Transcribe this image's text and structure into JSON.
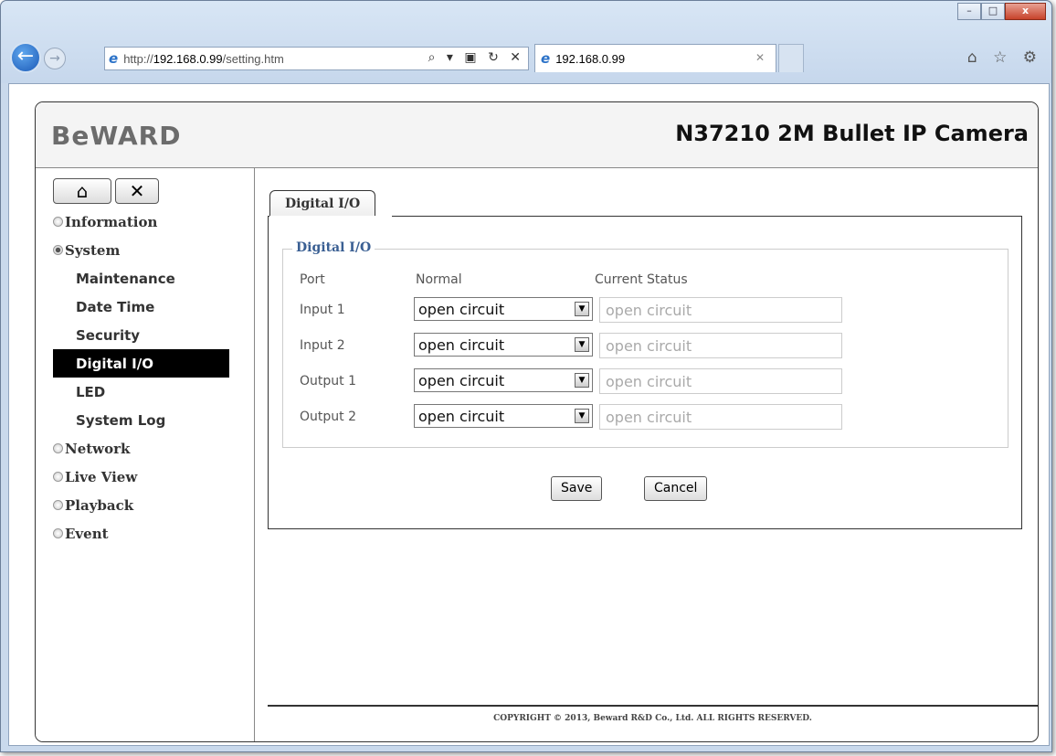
{
  "browser": {
    "url_prefix": "http://",
    "url_host": "192.168.0.99",
    "url_path": "/setting.htm",
    "address_tools": "⌕ ▾ ▣ ↻ ✕",
    "tab_title": "192.168.0.99",
    "tab_close": "✕",
    "back_glyph": "←",
    "forward_glyph": "→",
    "ie_glyph": "e",
    "right_icons": "⌂ ☆ ⚙",
    "min_glyph": "–",
    "max_glyph": "□",
    "close_glyph": "x"
  },
  "header": {
    "logo": "BeWARD",
    "model": "N37210 2M Bullet IP Camera"
  },
  "sidebar": {
    "home_glyph": "⌂",
    "tools_glyph": "✕",
    "sections": [
      {
        "label": "Information",
        "open": false
      },
      {
        "label": "System",
        "open": true
      },
      {
        "label": "Network",
        "open": false
      },
      {
        "label": "Live View",
        "open": false
      },
      {
        "label": "Playback",
        "open": false
      },
      {
        "label": "Event",
        "open": false
      }
    ],
    "system_items": [
      "Maintenance",
      "Date Time",
      "Security",
      "Digital I/O",
      "LED",
      "System Log"
    ],
    "active_item": "Digital I/O"
  },
  "main": {
    "tab_label": "Digital I/O",
    "legend": "Digital I/O",
    "columns": {
      "port": "Port",
      "normal": "Normal",
      "status": "Current Status"
    },
    "rows": [
      {
        "port": "Input 1",
        "normal": "open circuit",
        "status": "open circuit"
      },
      {
        "port": "Input 2",
        "normal": "open circuit",
        "status": "open circuit"
      },
      {
        "port": "Output 1",
        "normal": "open circuit",
        "status": "open circuit"
      },
      {
        "port": "Output 2",
        "normal": "open circuit",
        "status": "open circuit"
      }
    ],
    "save_label": "Save",
    "cancel_label": "Cancel",
    "select_arrow": "▼"
  },
  "footer": {
    "copyright": "COPYRIGHT © 2013, Beward R&D Co., Ltd. ALL RIGHTS RESERVED."
  }
}
